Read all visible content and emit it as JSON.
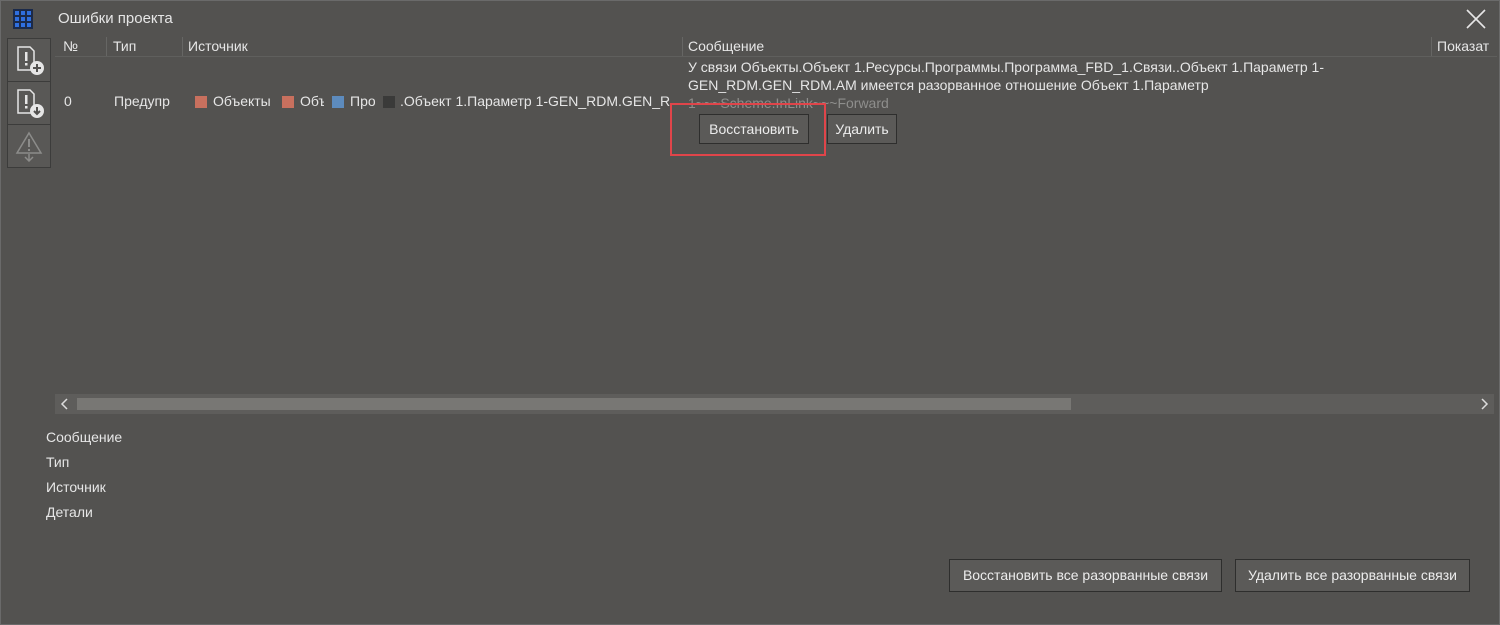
{
  "window": {
    "title": "Ошибки проекта",
    "app_icon": "grid-app-icon",
    "close_icon": "close-icon"
  },
  "toolbar": {
    "items": [
      {
        "name": "add-error-icon"
      },
      {
        "name": "download-error-icon"
      },
      {
        "name": "warning-filter-icon"
      }
    ]
  },
  "table": {
    "headers": {
      "num": "№",
      "type": "Тип",
      "source": "Источник",
      "message": "Сообщение",
      "show": "Показат"
    },
    "rows": [
      {
        "num": "0",
        "type": "Предупр",
        "source_chips": [
          {
            "label": "Объекты",
            "color": "#c8705e"
          },
          {
            "label": "Объ",
            "color": "#c8705e"
          },
          {
            "label": "Про",
            "color": "#5d8bbd"
          },
          {
            "label": ".Объект 1.Параметр 1-GEN_RDM.GEN_R",
            "color": "#3a3a39"
          }
        ],
        "message_lines": [
          "У связи Объекты.Объект 1.Ресурсы.Программы.Программа_FBD_1.Связи..Объект 1.Параметр 1-",
          "GEN_RDM.GEN_RDM.AM имеется разорванное отношение Объект 1.Параметр",
          "1~~~Scheme.InLink~~~Forward"
        ],
        "restore_label": "Восстановить",
        "delete_label": "Удалить"
      }
    ]
  },
  "details": {
    "message": "Сообщение",
    "type": "Тип",
    "source": "Источник",
    "details": "Детали"
  },
  "footer": {
    "restore_all": "Восстановить все разорванные связи",
    "delete_all": "Удалить все разорванные связи"
  },
  "colors": {
    "background": "#535250",
    "highlight": "#e0454a"
  }
}
